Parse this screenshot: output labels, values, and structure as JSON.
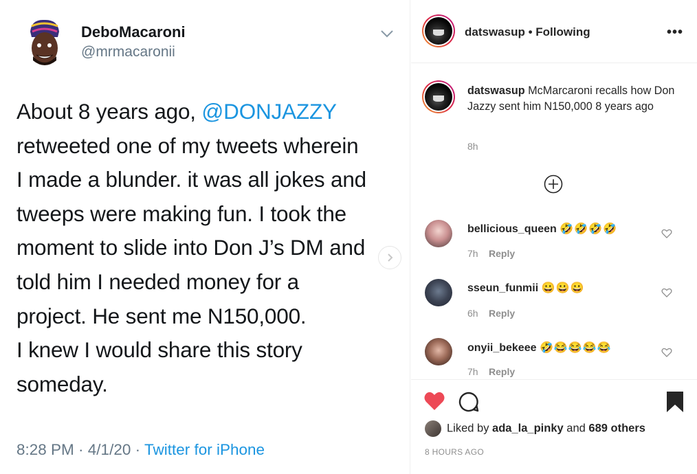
{
  "tweet": {
    "display_name": "DeboMacaroni",
    "handle": "@mrmacaronii",
    "body_lines": [
      {
        "pre": "About 8 years ago, ",
        "mention": "@DONJAZZY"
      },
      {
        "pre": "retweeted one of my tweets wherein"
      },
      {
        "pre": "I made a blunder. it was all jokes and"
      },
      {
        "pre": "tweeps were making fun. I took the"
      },
      {
        "pre": "moment to slide into Don J’s DM and"
      },
      {
        "pre": "told him I needed money for a"
      },
      {
        "pre": "project. He sent me N150,000."
      },
      {
        "pre": "I knew I would share this story"
      },
      {
        "pre": "someday."
      }
    ],
    "time": "8:28 PM · 4/1/20 · ",
    "source": "Twitter for iPhone"
  },
  "post": {
    "username": "datswasup",
    "separator": "•",
    "follow_state": "Following",
    "more_label": "•••",
    "caption_user": "datswasup",
    "caption_text": "McMarcaroni recalls how Don Jazzy sent him N150,000 8 years ago",
    "caption_time": "8h",
    "comments": [
      {
        "user": "bellicious_queen",
        "emoji": "🤣🤣🤣🤣",
        "time": "7h",
        "reply": "Reply"
      },
      {
        "user": "sseun_funmii",
        "emoji": "😀😀😀",
        "time": "6h",
        "reply": "Reply"
      },
      {
        "user": "onyii_bekeee",
        "emoji": "🤣😂😂😂😂",
        "time": "7h",
        "reply": "Reply"
      }
    ],
    "liked_prefix": "Liked by ",
    "liked_user": "ada_la_pinky",
    "liked_and": " and ",
    "liked_others": "689 others",
    "timestamp": "8 HOURS AGO"
  },
  "colors": {
    "like_red": "#ed4956",
    "link_blue": "#1b95e0",
    "muted": "#8e8e8e"
  }
}
